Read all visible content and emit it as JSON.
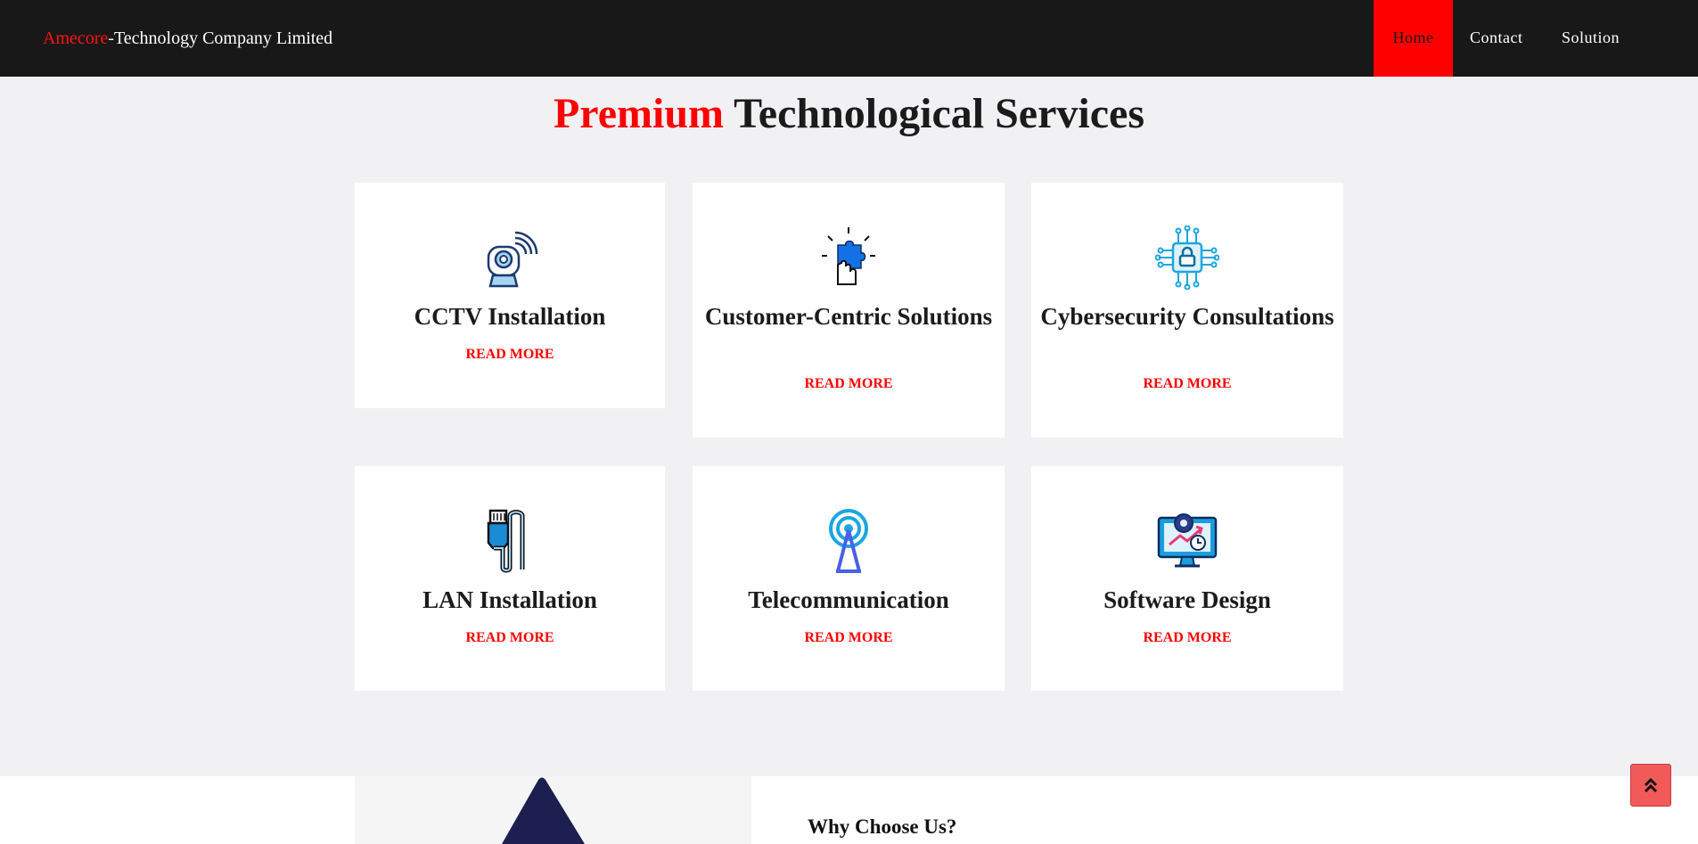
{
  "header": {
    "brand_accent": "Amecore",
    "brand_rest": "-Technology Company Limited",
    "nav": {
      "home": "Home",
      "contact": "Contact",
      "solution": "Solution"
    },
    "active_item": "Home"
  },
  "services": {
    "title_accent": "Premium",
    "title_rest": " Technological Services",
    "read_more": "READ MORE",
    "items": [
      {
        "title": "CCTV Installation",
        "icon": "cctv-camera-icon"
      },
      {
        "title": "Customer-Centric Solutions",
        "icon": "puzzle-hand-icon"
      },
      {
        "title": "Cybersecurity Consultations",
        "icon": "circuit-lock-icon"
      },
      {
        "title": "LAN Installation",
        "icon": "ethernet-cable-icon"
      },
      {
        "title": "Telecommunication",
        "icon": "antenna-tower-icon"
      },
      {
        "title": "Software Design",
        "icon": "monitor-gear-icon"
      }
    ]
  },
  "why_section": {
    "heading": "Why Choose Us?"
  },
  "back_to_top": {
    "icon": "double-chevron-up-icon"
  },
  "colors": {
    "accent": "#ff0000",
    "navbar": "#181818",
    "page_bg": "#f1f1f3",
    "card_bg": "#ffffff",
    "back_to_top": "#f25a5a",
    "triangle": "#1c1f4f"
  }
}
